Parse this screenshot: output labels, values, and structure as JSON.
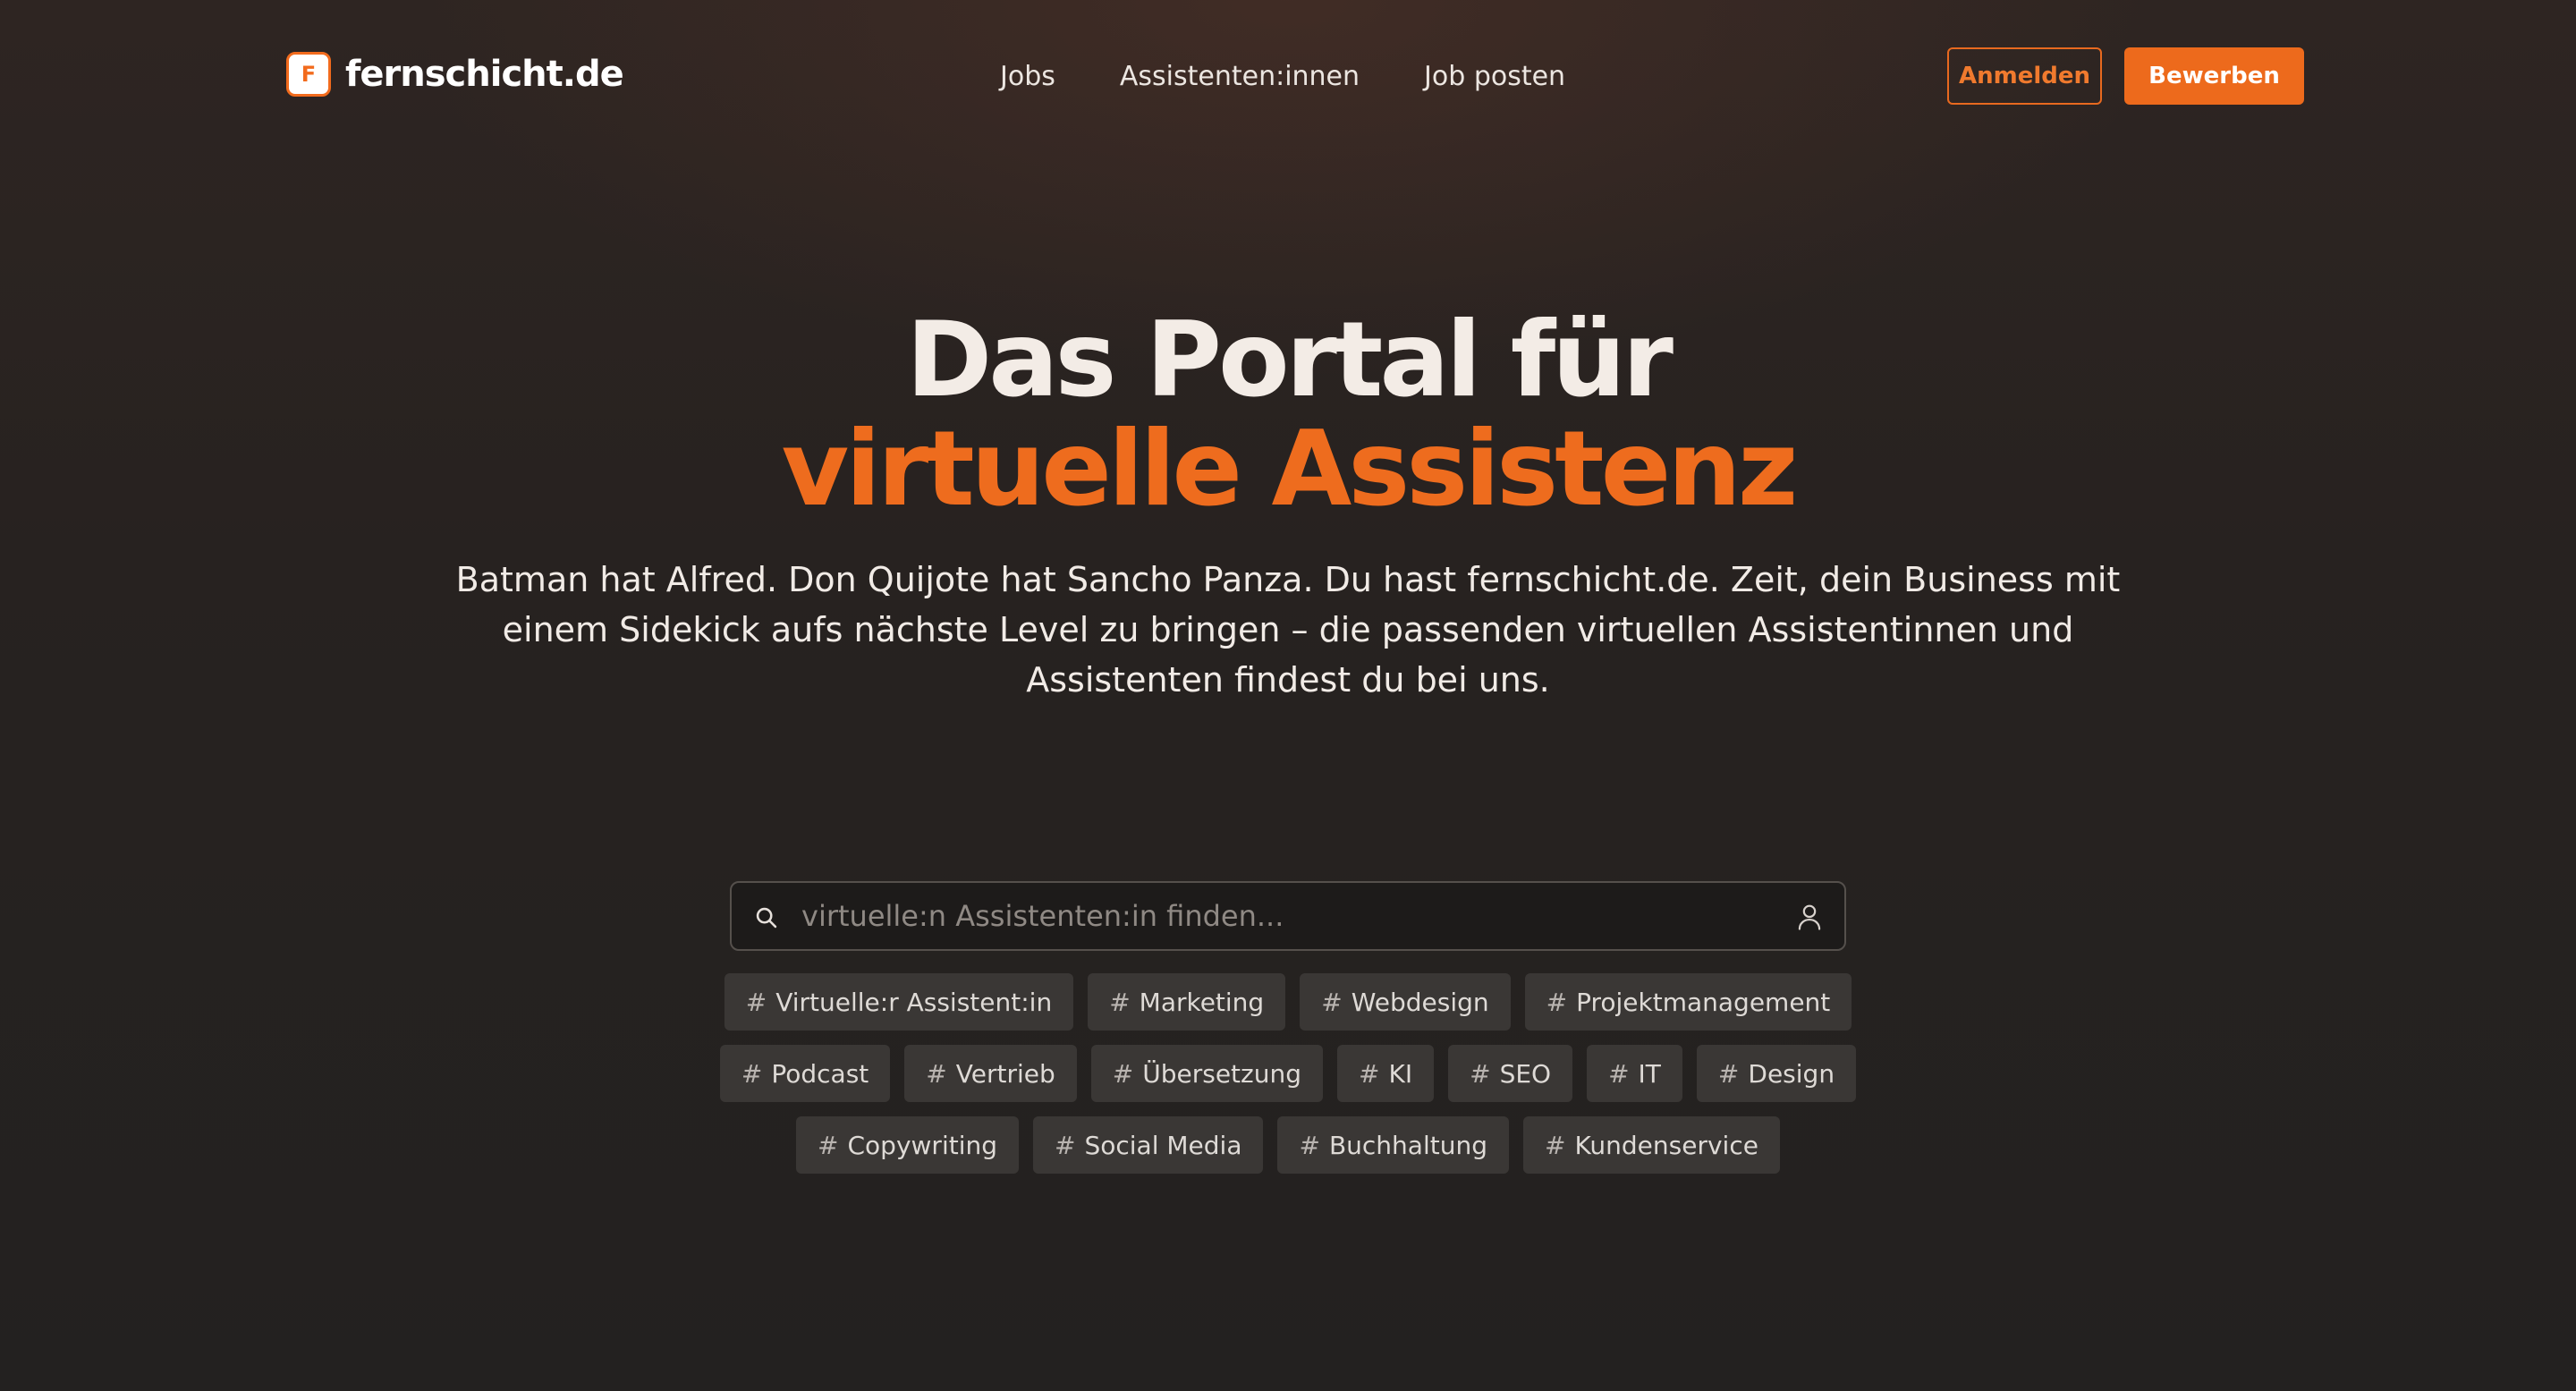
{
  "brand": {
    "logo_letter": "F",
    "name": "fernschicht.de",
    "accent_color": "#ED6A1C"
  },
  "nav": {
    "items": [
      {
        "label": "Jobs"
      },
      {
        "label": "Assistenten:innen"
      },
      {
        "label": "Job posten"
      }
    ]
  },
  "actions": {
    "login_label": "Anmelden",
    "apply_label": "Bewerben"
  },
  "hero": {
    "title_line1": "Das Portal für",
    "title_line2": "virtuelle Assistenz",
    "subtitle": "Batman hat Alfred. Don Quijote hat Sancho Panza. Du hast fernschicht.de. Zeit, dein Business mit einem Sidekick aufs nächste Level zu bringen – die passenden virtuellen Assistentinnen und Assistenten findest du bei uns."
  },
  "search": {
    "placeholder": "virtuelle:n Assistenten:in finden...",
    "value": "",
    "left_icon": "search-icon",
    "right_icon": "user-icon"
  },
  "tags": [
    {
      "label": "Virtuelle:r Assistent:in"
    },
    {
      "label": "Marketing"
    },
    {
      "label": "Webdesign"
    },
    {
      "label": "Projektmanagement"
    },
    {
      "label": "Podcast"
    },
    {
      "label": "Vertrieb"
    },
    {
      "label": "Übersetzung"
    },
    {
      "label": "KI"
    },
    {
      "label": "SEO"
    },
    {
      "label": "IT"
    },
    {
      "label": "Design"
    },
    {
      "label": "Copywriting"
    },
    {
      "label": "Social Media"
    },
    {
      "label": "Buchhaltung"
    },
    {
      "label": "Kundenservice"
    }
  ],
  "tag_prefix": "#"
}
